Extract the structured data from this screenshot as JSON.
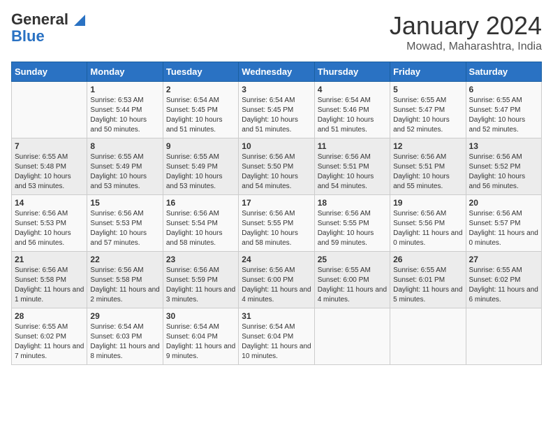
{
  "header": {
    "logo_line1": "General",
    "logo_line2": "Blue",
    "main_title": "January 2024",
    "subtitle": "Mowad, Maharashtra, India"
  },
  "days_of_week": [
    "Sunday",
    "Monday",
    "Tuesday",
    "Wednesday",
    "Thursday",
    "Friday",
    "Saturday"
  ],
  "weeks": [
    [
      {
        "day": "",
        "info": ""
      },
      {
        "day": "1",
        "info": "Sunrise: 6:53 AM\nSunset: 5:44 PM\nDaylight: 10 hours\nand 50 minutes."
      },
      {
        "day": "2",
        "info": "Sunrise: 6:54 AM\nSunset: 5:45 PM\nDaylight: 10 hours\nand 51 minutes."
      },
      {
        "day": "3",
        "info": "Sunrise: 6:54 AM\nSunset: 5:45 PM\nDaylight: 10 hours\nand 51 minutes."
      },
      {
        "day": "4",
        "info": "Sunrise: 6:54 AM\nSunset: 5:46 PM\nDaylight: 10 hours\nand 51 minutes."
      },
      {
        "day": "5",
        "info": "Sunrise: 6:55 AM\nSunset: 5:47 PM\nDaylight: 10 hours\nand 52 minutes."
      },
      {
        "day": "6",
        "info": "Sunrise: 6:55 AM\nSunset: 5:47 PM\nDaylight: 10 hours\nand 52 minutes."
      }
    ],
    [
      {
        "day": "7",
        "info": "Sunrise: 6:55 AM\nSunset: 5:48 PM\nDaylight: 10 hours\nand 53 minutes."
      },
      {
        "day": "8",
        "info": "Sunrise: 6:55 AM\nSunset: 5:49 PM\nDaylight: 10 hours\nand 53 minutes."
      },
      {
        "day": "9",
        "info": "Sunrise: 6:55 AM\nSunset: 5:49 PM\nDaylight: 10 hours\nand 53 minutes."
      },
      {
        "day": "10",
        "info": "Sunrise: 6:56 AM\nSunset: 5:50 PM\nDaylight: 10 hours\nand 54 minutes."
      },
      {
        "day": "11",
        "info": "Sunrise: 6:56 AM\nSunset: 5:51 PM\nDaylight: 10 hours\nand 54 minutes."
      },
      {
        "day": "12",
        "info": "Sunrise: 6:56 AM\nSunset: 5:51 PM\nDaylight: 10 hours\nand 55 minutes."
      },
      {
        "day": "13",
        "info": "Sunrise: 6:56 AM\nSunset: 5:52 PM\nDaylight: 10 hours\nand 56 minutes."
      }
    ],
    [
      {
        "day": "14",
        "info": "Sunrise: 6:56 AM\nSunset: 5:53 PM\nDaylight: 10 hours\nand 56 minutes."
      },
      {
        "day": "15",
        "info": "Sunrise: 6:56 AM\nSunset: 5:53 PM\nDaylight: 10 hours\nand 57 minutes."
      },
      {
        "day": "16",
        "info": "Sunrise: 6:56 AM\nSunset: 5:54 PM\nDaylight: 10 hours\nand 58 minutes."
      },
      {
        "day": "17",
        "info": "Sunrise: 6:56 AM\nSunset: 5:55 PM\nDaylight: 10 hours\nand 58 minutes."
      },
      {
        "day": "18",
        "info": "Sunrise: 6:56 AM\nSunset: 5:55 PM\nDaylight: 10 hours\nand 59 minutes."
      },
      {
        "day": "19",
        "info": "Sunrise: 6:56 AM\nSunset: 5:56 PM\nDaylight: 11 hours\nand 0 minutes."
      },
      {
        "day": "20",
        "info": "Sunrise: 6:56 AM\nSunset: 5:57 PM\nDaylight: 11 hours\nand 0 minutes."
      }
    ],
    [
      {
        "day": "21",
        "info": "Sunrise: 6:56 AM\nSunset: 5:58 PM\nDaylight: 11 hours\nand 1 minute."
      },
      {
        "day": "22",
        "info": "Sunrise: 6:56 AM\nSunset: 5:58 PM\nDaylight: 11 hours\nand 2 minutes."
      },
      {
        "day": "23",
        "info": "Sunrise: 6:56 AM\nSunset: 5:59 PM\nDaylight: 11 hours\nand 3 minutes."
      },
      {
        "day": "24",
        "info": "Sunrise: 6:56 AM\nSunset: 6:00 PM\nDaylight: 11 hours\nand 4 minutes."
      },
      {
        "day": "25",
        "info": "Sunrise: 6:55 AM\nSunset: 6:00 PM\nDaylight: 11 hours\nand 4 minutes."
      },
      {
        "day": "26",
        "info": "Sunrise: 6:55 AM\nSunset: 6:01 PM\nDaylight: 11 hours\nand 5 minutes."
      },
      {
        "day": "27",
        "info": "Sunrise: 6:55 AM\nSunset: 6:02 PM\nDaylight: 11 hours\nand 6 minutes."
      }
    ],
    [
      {
        "day": "28",
        "info": "Sunrise: 6:55 AM\nSunset: 6:02 PM\nDaylight: 11 hours\nand 7 minutes."
      },
      {
        "day": "29",
        "info": "Sunrise: 6:54 AM\nSunset: 6:03 PM\nDaylight: 11 hours\nand 8 minutes."
      },
      {
        "day": "30",
        "info": "Sunrise: 6:54 AM\nSunset: 6:04 PM\nDaylight: 11 hours\nand 9 minutes."
      },
      {
        "day": "31",
        "info": "Sunrise: 6:54 AM\nSunset: 6:04 PM\nDaylight: 11 hours\nand 10 minutes."
      },
      {
        "day": "",
        "info": ""
      },
      {
        "day": "",
        "info": ""
      },
      {
        "day": "",
        "info": ""
      }
    ]
  ]
}
